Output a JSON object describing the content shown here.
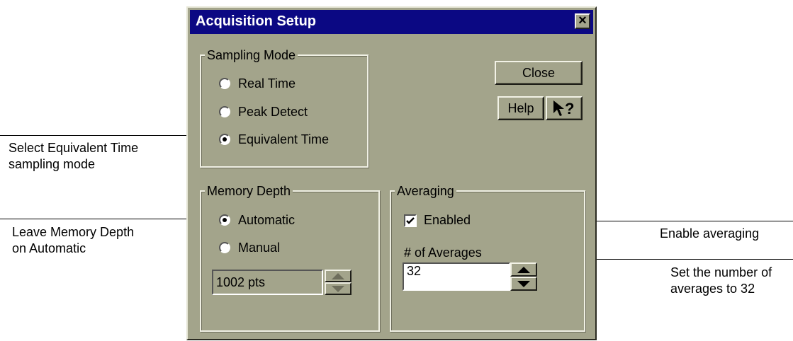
{
  "dialog": {
    "title": "Acquisition Setup",
    "close_x": "×",
    "close_button": "Close",
    "help_button": "Help",
    "whats_this_button": "?"
  },
  "sampling_mode": {
    "legend": "Sampling Mode",
    "options": [
      "Real Time",
      "Peak Detect",
      "Equivalent Time"
    ],
    "selected": "Equivalent Time"
  },
  "memory_depth": {
    "legend": "Memory Depth",
    "options": [
      "Automatic",
      "Manual"
    ],
    "selected": "Automatic",
    "value": "1002 pts"
  },
  "averaging": {
    "legend": "Averaging",
    "enabled_label": "Enabled",
    "enabled": true,
    "count_label": "# of Averages",
    "count_value": "32"
  },
  "annotations": {
    "equivalent_time": [
      "Select Equivalent Time",
      "sampling mode"
    ],
    "memory_depth": [
      "Leave Memory Depth",
      "on Automatic"
    ],
    "enable_averaging": [
      "Enable averaging"
    ],
    "number_of_averages": [
      "Set the number of",
      "averages to 32"
    ]
  }
}
